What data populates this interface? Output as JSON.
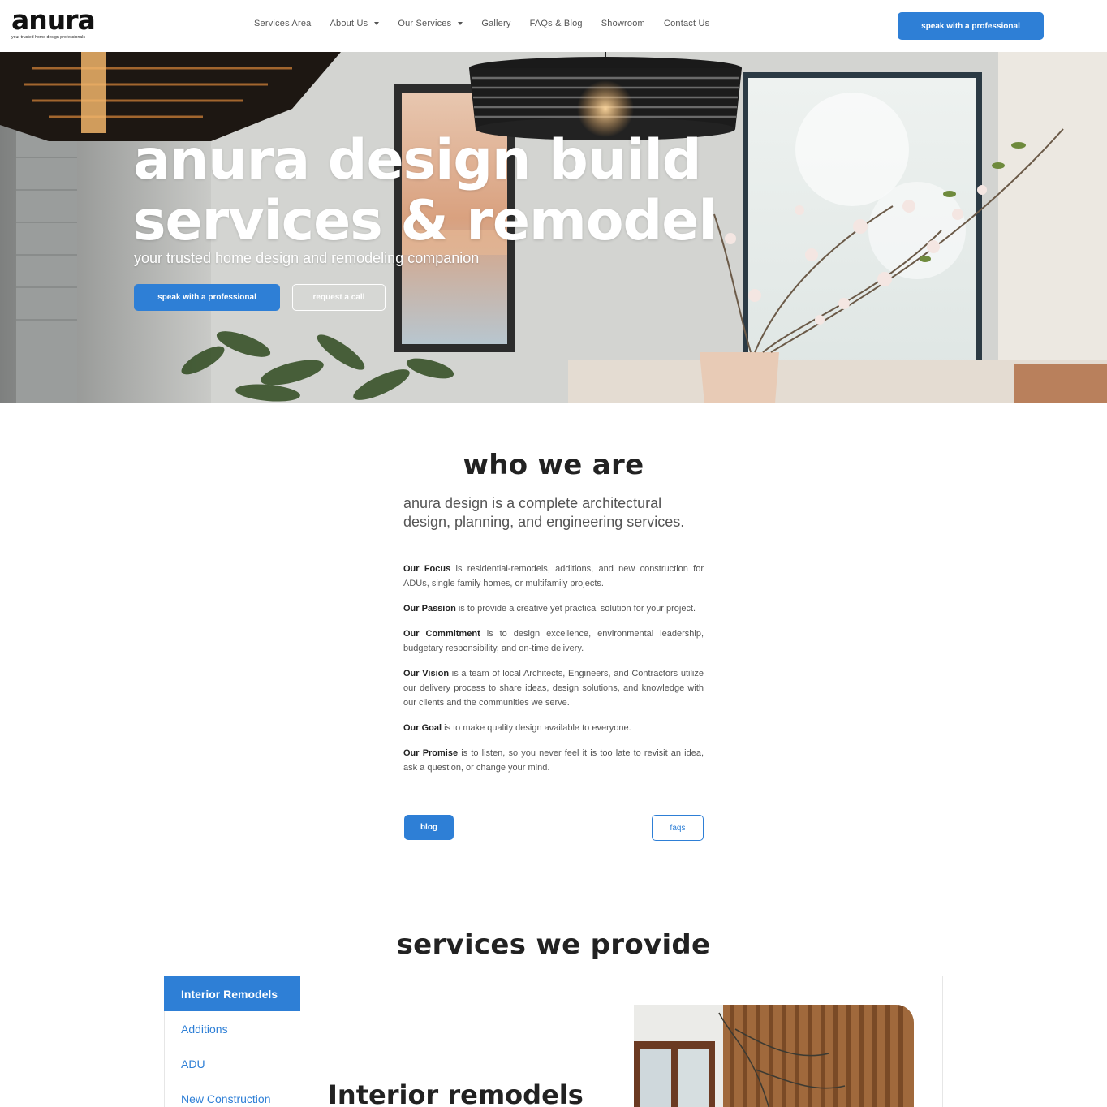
{
  "brand": {
    "logo": "anura",
    "tagline": "your trusted home design professionals"
  },
  "nav": {
    "items": [
      {
        "label": "Services Area",
        "dropdown": false
      },
      {
        "label": "About Us",
        "dropdown": true
      },
      {
        "label": "Our Services",
        "dropdown": true
      },
      {
        "label": "Gallery",
        "dropdown": false
      },
      {
        "label": "FAQs & Blog",
        "dropdown": false
      },
      {
        "label": "Showroom",
        "dropdown": false
      },
      {
        "label": "Contact Us",
        "dropdown": false
      }
    ],
    "cta_label": "speak with a professional"
  },
  "hero": {
    "title_line1": "anura design build",
    "title_line2": "services & remodel",
    "subtitle": "your trusted home design and remodeling companion",
    "cta_primary": "speak with a professional",
    "cta_secondary": "request a call"
  },
  "who": {
    "title": "who we are",
    "lead": "anura design is a complete architectural design, planning, and engineering services.",
    "items": [
      {
        "label": "Our Focus",
        "text": " is residential-remodels, additions, and new construction for ADUs, single family homes, or multifamily projects."
      },
      {
        "label": "Our Passion",
        "text": " is to provide a creative yet practical solution for your project."
      },
      {
        "label": "Our Commitment",
        "text": " is to design excellence, environmental leadership, budgetary responsibility, and on-time delivery."
      },
      {
        "label": "Our Vision",
        "text": " is a team of local Architects, Engineers, and Contractors utilize our delivery process to share ideas, design solutions, and knowledge with our clients and the communities we serve."
      },
      {
        "label": "Our Goal",
        "text": " is to make quality design available to everyone."
      },
      {
        "label": "Our Promise",
        "text": " is to listen, so you never feel it is too late to revisit an idea, ask a question, or change your mind."
      }
    ],
    "btn_blog": "blog",
    "btn_faqs": "faqs"
  },
  "services": {
    "title": "services we provide",
    "tabs": [
      "Interior Remodels",
      "Additions",
      "ADU",
      "New Construction"
    ],
    "active_tab": "Interior Remodels",
    "panel_heading": "Interior remodels"
  },
  "colors": {
    "accent": "#2e7fd6",
    "text_dark": "#222222",
    "text_muted": "#555555"
  }
}
